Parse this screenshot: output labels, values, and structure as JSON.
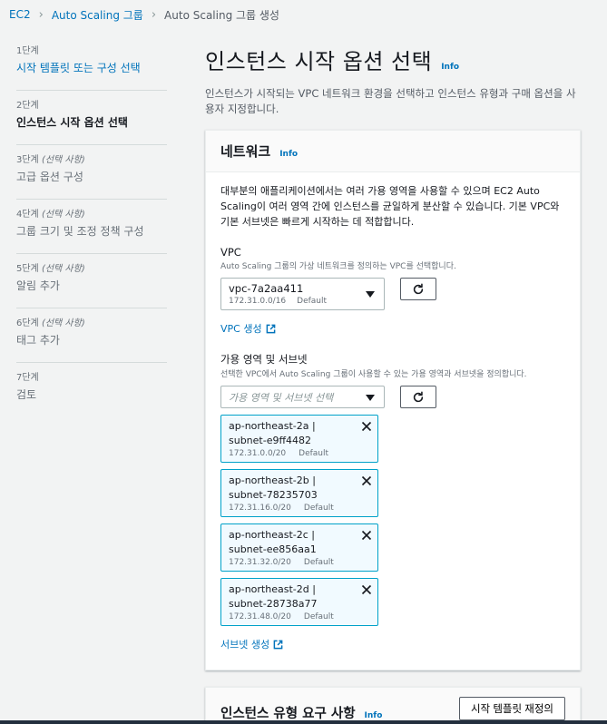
{
  "breadcrumb": [
    "EC2",
    "Auto Scaling 그룹",
    "Auto Scaling 그룹 생성"
  ],
  "steps": [
    {
      "num": "1단계",
      "optional": "",
      "name": "시작 템플릿 또는 구성 선택"
    },
    {
      "num": "2단계",
      "optional": "",
      "name": "인스턴스 시작 옵션 선택"
    },
    {
      "num": "3단계",
      "optional": "(선택 사항)",
      "name": "고급 옵션 구성"
    },
    {
      "num": "4단계",
      "optional": "(선택 사항)",
      "name": "그룹 크기 및 조정 정책 구성"
    },
    {
      "num": "5단계",
      "optional": "(선택 사항)",
      "name": "알림 추가"
    },
    {
      "num": "6단계",
      "optional": "(선택 사항)",
      "name": "태그 추가"
    },
    {
      "num": "7단계",
      "optional": "",
      "name": "검토"
    }
  ],
  "page": {
    "title": "인스턴스 시작 옵션 선택",
    "info": "Info",
    "description": "인스턴스가 시작되는 VPC 네트워크 환경을 선택하고 인스턴스 유형과 구매 옵션을 사용자 지정합니다."
  },
  "network": {
    "title": "네트워크",
    "info": "Info",
    "body": "대부분의 애플리케이션에서는 여러 가용 영역을 사용할 수 있으며 EC2 Auto Scaling이 여러 영역 간에 인스턴스를 균일하게 분산할 수 있습니다. 기본 VPC와 기본 서브넷은 빠르게 시작하는 데 적합합니다.",
    "vpc_label": "VPC",
    "vpc_desc": "Auto Scaling 그룹의 가상 네트워크를 정의하는 VPC를 선택합니다.",
    "vpc_value": "vpc-7a2aa411",
    "vpc_cidr": "172.31.0.0/16",
    "vpc_default": "Default",
    "vpc_create": "VPC 생성",
    "az_label": "가용 영역 및 서브넷",
    "az_desc": "선택한 VPC에서 Auto Scaling 그룹이 사용할 수 있는 가용 영역과 서브넷을 정의합니다.",
    "az_placeholder": "가용 영역 및 서브넷 선택",
    "subnets": [
      {
        "name": "ap-northeast-2a | subnet-e9ff4482",
        "cidr": "172.31.0.0/20",
        "tag": "Default"
      },
      {
        "name": "ap-northeast-2b | subnet-78235703",
        "cidr": "172.31.16.0/20",
        "tag": "Default"
      },
      {
        "name": "ap-northeast-2c | subnet-ee856aa1",
        "cidr": "172.31.32.0/20",
        "tag": "Default"
      },
      {
        "name": "ap-northeast-2d | subnet-28738a77",
        "cidr": "172.31.48.0/20",
        "tag": "Default"
      }
    ],
    "subnet_create": "서브넷 생성"
  },
  "instance_req": {
    "title": "인스턴스 유형 요구 사항",
    "info": "Info",
    "button": "시작 템플릿 재정의"
  }
}
